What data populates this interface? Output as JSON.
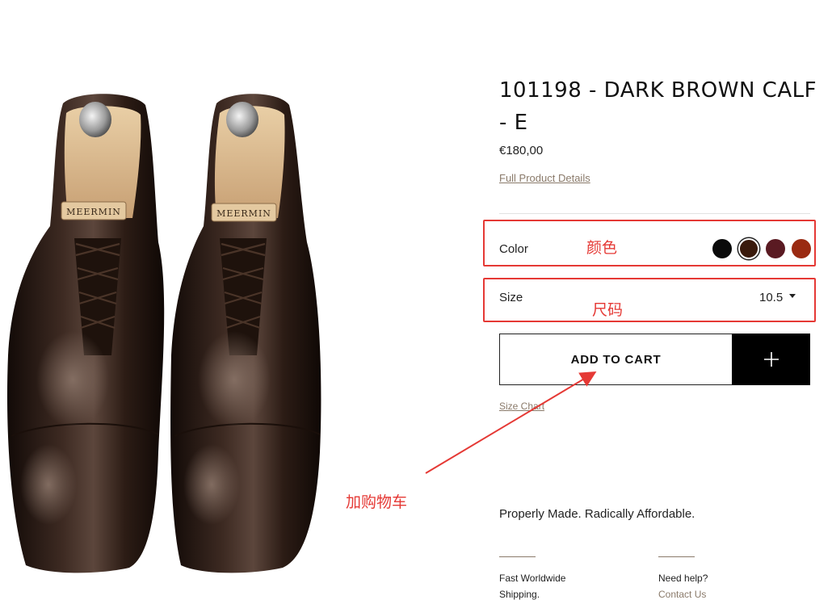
{
  "product": {
    "title": "101198 - DARK BROWN CALF - E",
    "price": "€180,00",
    "details_link": "Full Product Details",
    "brand_stamp": "MEERMIN"
  },
  "options": {
    "color": {
      "label": "Color",
      "swatches": [
        {
          "name": "black",
          "hex": "#0a0a0a",
          "selected": false
        },
        {
          "name": "dark-brown",
          "hex": "#3a1a0c",
          "selected": true
        },
        {
          "name": "burgundy",
          "hex": "#5a1a22",
          "selected": false
        },
        {
          "name": "rust",
          "hex": "#9a2a12",
          "selected": false
        }
      ]
    },
    "size": {
      "label": "Size",
      "value": "10.5"
    }
  },
  "cart": {
    "add_label": "ADD TO CART",
    "plus_icon": "plus-icon"
  },
  "size_chart_link": "Size Chart",
  "tagline": "Properly Made. Radically Affordable.",
  "footer": {
    "shipping_line1": "Fast Worldwide",
    "shipping_line2": "Shipping.",
    "help_line1": "Need help?",
    "help_link": "Contact Us"
  },
  "annotations": {
    "color": "颜色",
    "size": "尺码",
    "add_to_cart": "加购物车",
    "accent": "#e53935"
  }
}
